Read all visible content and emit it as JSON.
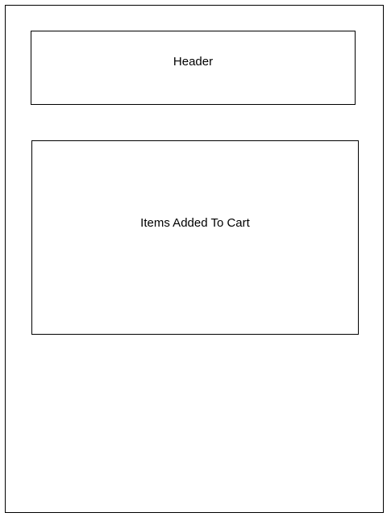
{
  "header": {
    "label": "Header"
  },
  "cart": {
    "label": "Items Added To Cart"
  },
  "colors": {
    "stroke": "#000000",
    "background": "#ffffff"
  }
}
